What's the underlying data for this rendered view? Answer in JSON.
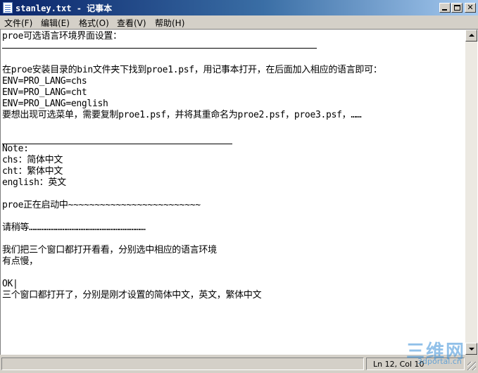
{
  "window": {
    "title": "stanley.txt - 记事本"
  },
  "menu": {
    "file": "文件(F)",
    "edit": "编辑(E)",
    "format": "格式(O)",
    "view": "查看(V)",
    "help": "帮助(H)"
  },
  "document": {
    "lines": [
      "proe可选语言环境界面设置：",
      "",
      "",
      "在proe安装目录的bin文件夹下找到proe1.psf，用记事本打开，在后面加入相应的语言即可：",
      "ENV=PRO_LANG=chs",
      "ENV=PRO_LANG=cht",
      "ENV=PRO_LANG=english",
      "要想出现可选菜单，需要复制proe1.psf，并将其重命名为proe2.psf，proe3.psf，……",
      "",
      "",
      "Note:",
      "chs：简体中文",
      "cht：繁体中文",
      "english：英文",
      "",
      "proe正在启动中~~~~~~~~~~~~~~~~~~~~~~~~~",
      "",
      "请稍等…………………………………………………………",
      "",
      "我们把三个窗口都打开看看，分别选中相应的语言环境",
      "有点慢，",
      "",
      "OK|",
      "三个窗口都打开了，分别是刚才设置的简体中文，英文，繁体中文"
    ]
  },
  "statusbar": {
    "position": "Ln 12, Col 10"
  },
  "watermark": {
    "logo": "三维网",
    "url": "3dportal.cn"
  },
  "icons": {
    "app": "notepad-icon",
    "minimize": "minimize-icon",
    "maximize": "maximize-icon",
    "close": "close-icon",
    "scroll_up": "arrow-up-icon",
    "scroll_down": "arrow-down-icon",
    "grip": "resize-grip-icon"
  },
  "colors": {
    "titlebar_start": "#0a246a",
    "titlebar_end": "#a6caf0",
    "chrome": "#d4d0c8",
    "text": "#000000",
    "watermark": "#3a8fd8"
  }
}
